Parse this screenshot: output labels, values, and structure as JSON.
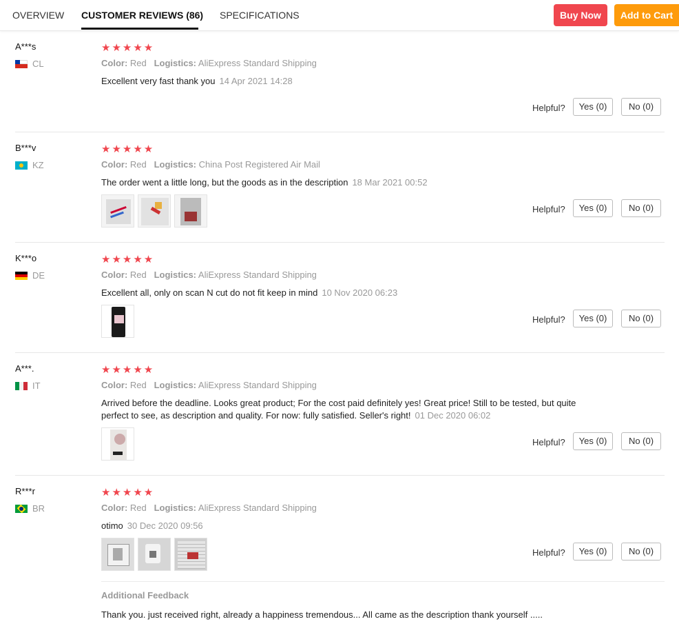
{
  "tabs": {
    "overview": "OVERVIEW",
    "reviews": "CUSTOMER REVIEWS (86)",
    "specifications": "SPECIFICATIONS"
  },
  "actions": {
    "buy_now": "Buy Now",
    "add_to_cart": "Add to Cart"
  },
  "labels": {
    "color": "Color:",
    "logistics": "Logistics:",
    "helpful": "Helpful?",
    "stars": "★★★★★"
  },
  "reviews": [
    {
      "user": "A***s",
      "country": "CL",
      "color": "Red",
      "logistics": "AliExpress Standard Shipping",
      "text": "Excellent very fast thank you",
      "date": "14 Apr 2021 14:28",
      "yes": "Yes (0)",
      "no": "No (0)"
    },
    {
      "user": "B***v",
      "country": "KZ",
      "color": "Red",
      "logistics": "China Post Registered Air Mail",
      "text": "The order went a little long, but the goods as in the description",
      "date": "18 Mar 2021 00:52",
      "yes": "Yes (0)",
      "no": "No (0)"
    },
    {
      "user": "K***o",
      "country": "DE",
      "color": "Red",
      "logistics": "AliExpress Standard Shipping",
      "text": "Excellent all, only on scan N cut do not fit keep in mind",
      "date": "10 Nov 2020 06:23",
      "yes": "Yes (0)",
      "no": "No (0)"
    },
    {
      "user": "A***.",
      "country": "IT",
      "color": "Red",
      "logistics": "AliExpress Standard Shipping",
      "text": "Arrived before the deadline. Looks great product; For the cost paid definitely yes! Great price! Still to be tested, but quite perfect to see, as description and quality. For now: fully satisfied. Seller's right!",
      "date": "01 Dec 2020 06:02",
      "yes": "Yes (0)",
      "no": "No (0)"
    },
    {
      "user": "R***r",
      "country": "BR",
      "color": "Red",
      "logistics": "AliExpress Standard Shipping",
      "text": "otimo",
      "date": "30 Dec 2020 09:56",
      "yes": "Yes (0)",
      "no": "No (0)",
      "additional_title": "Additional Feedback",
      "additional_text": "Thank you. just received right, already a happiness tremendous... All came as the description thank yourself ....."
    }
  ],
  "colors": {
    "accent_red": "#f0464e",
    "accent_orange": "#fe9b0b",
    "muted": "#999999"
  }
}
